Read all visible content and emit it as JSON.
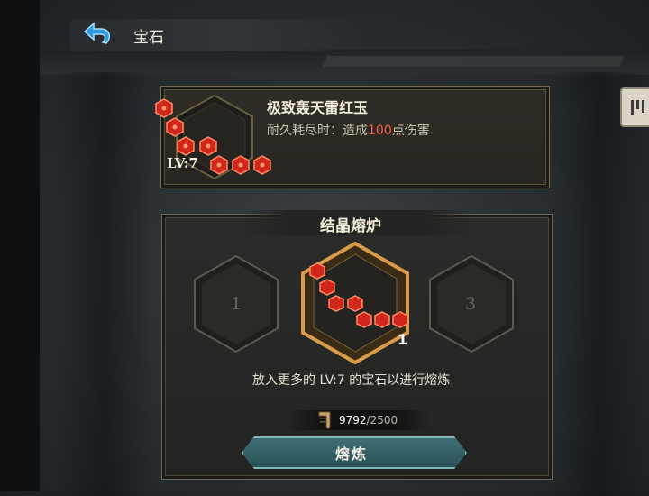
{
  "header": {
    "title": "宝石"
  },
  "gem": {
    "name": "极致轰天雷红玉",
    "desc_prefix": "耐久耗尽时：造成",
    "damage": "100",
    "desc_suffix": "点伤害",
    "level": "LV:7"
  },
  "furnace": {
    "title": "结晶熔炉",
    "slots": [
      {
        "label": "1"
      },
      {
        "count": "1"
      },
      {
        "label": "3"
      }
    ],
    "hint": "放入更多的 LV:7 的宝石以进行熔炼"
  },
  "cost": {
    "current": "9792",
    "required": "/2500"
  },
  "actions": {
    "smelt_label": "熔炼"
  },
  "colors": {
    "accent_teal": "#3f6e74",
    "damage_red": "#ff5a4a",
    "gold_frame": "#c9964b"
  },
  "icons": {
    "back": "back-arrow-icon",
    "scroll": "scroll-icon",
    "gem": "red-hex-gem-icon",
    "side_tab": "bars-icon"
  }
}
